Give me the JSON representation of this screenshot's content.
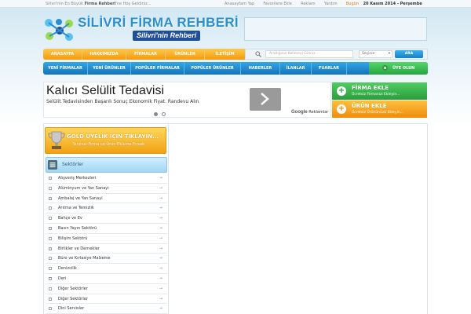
{
  "topbar": {
    "welcome_prefix": "Silivri'nin En Büyük",
    "welcome_brand": "Firma Rehberi",
    "welcome_suffix": "'ne Hoş Geldiniz...",
    "links": [
      "Anasayfam Yap",
      "Favorilere Ekle",
      "Reklam",
      "Yardım"
    ],
    "date_prefix": "Bugün",
    "date_value": "20 Kasım 2014 - Perşembe"
  },
  "logo": {
    "title": "SİLİVRİ FİRMA REHBERİ",
    "subtitle": "Silivri'nin Rehberi",
    "icon": "network-logo-icon"
  },
  "main_nav": {
    "items": [
      "ANASAYFA",
      "HAKKIMIZDA",
      "FİRMALAR",
      "ÜRÜNLER",
      "İLETİŞİM"
    ]
  },
  "search": {
    "placeholder": "Aradığınız Kelimeyi Giriniz",
    "select_value": "Seçiniz",
    "button": "ARA"
  },
  "sub_nav": {
    "items": [
      "YENİ FİRMALAR",
      "YENİ ÜRÜNLER",
      "POPÜLER FİRMALAR",
      "POPÜLER ÜRÜNLER",
      "HABERLER",
      "İLANLAR",
      "FUARLAR"
    ],
    "member": "ÜYE OLUN"
  },
  "ad": {
    "title": "Kalıcı Selülit Tedavisi",
    "description": "Selülit Tedavisinden Başarılı Sonuç Ekonomik Fiyat. Randevu Alın",
    "google": "Google",
    "google_label": "Reklamlar"
  },
  "cta": {
    "firma_title": "FİRMA EKLE",
    "firma_sub": "Ücretsiz Firmanızı Ekleyin...",
    "urun_title": "ÜRÜN EKLE",
    "urun_sub": "Ücretsiz Ürününüzü Ekleyin..."
  },
  "gold": {
    "title": "GOLD ÜYELİK İÇİN TIKLAYIN...",
    "subtitle": "Sınırsız Firma ve Ürün Ekleme Fırsatı"
  },
  "sectors": {
    "title": "Sektörler",
    "items": [
      "Alışveriş Merkezleri",
      "Alüminyum ve Yan Sanayi",
      "Ambalaj ve Yan Sanayi",
      "Arıtma ve Temizlik",
      "Bahçe ve Ev",
      "Basın Yayın Sektörü",
      "Bilişim Sektörü",
      "Birlikler ve Dernekler",
      "Büro ve Kırtasiye Malzeme",
      "Denizcilik",
      "Deri",
      "Diğer Sektörler",
      "Diğer Sektörler",
      "Dini Servisler"
    ]
  },
  "colors": {
    "orange": "#f39a10",
    "blue": "#1680c7",
    "green": "#2a9e3b",
    "gold": "#f0a215"
  }
}
